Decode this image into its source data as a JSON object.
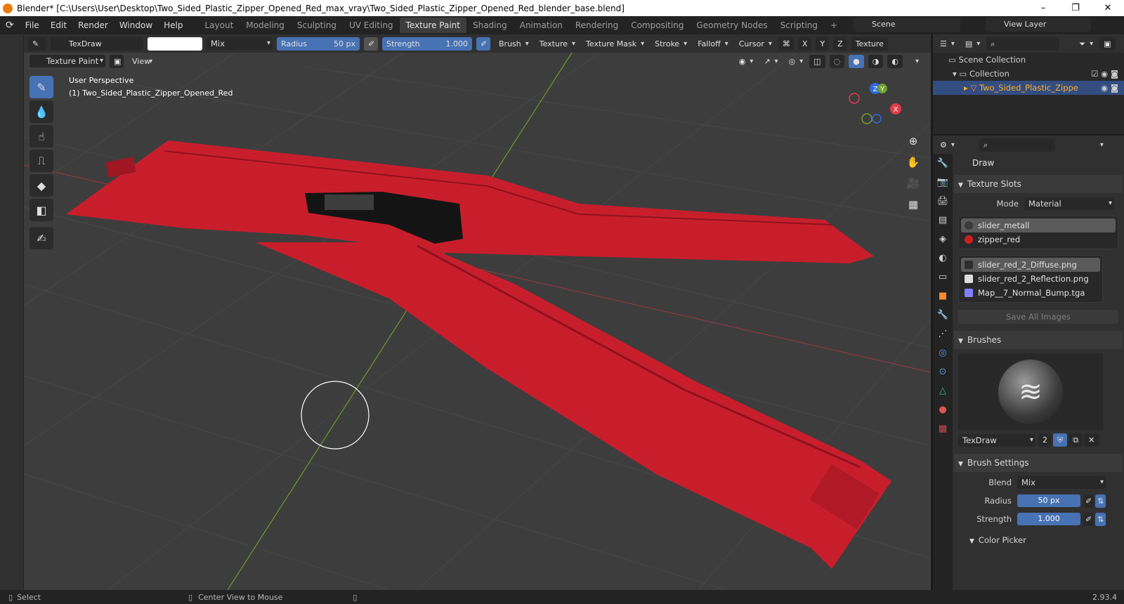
{
  "window": {
    "title": "Blender* [C:\\Users\\User\\Desktop\\Two_Sided_Plastic_Zipper_Opened_Red_max_vray\\Two_Sided_Plastic_Zipper_Opened_Red_blender_base.blend]",
    "minimize": "–",
    "maximize": "❐",
    "close": "✕"
  },
  "menu": [
    "File",
    "Edit",
    "Render",
    "Window",
    "Help"
  ],
  "workspaces": [
    "Layout",
    "Modeling",
    "Sculpting",
    "UV Editing",
    "Texture Paint",
    "Shading",
    "Animation",
    "Rendering",
    "Compositing",
    "Geometry Nodes",
    "Scripting",
    "+"
  ],
  "active_workspace": "Texture Paint",
  "scene": "Scene",
  "view_layer": "View Layer",
  "tool_header": {
    "brush_name": "TexDraw",
    "blend_mode": "Mix",
    "radius_label": "Radius",
    "radius_value": "50 px",
    "strength_label": "Strength",
    "strength_value": "1.000",
    "menus": [
      "Brush",
      "Texture",
      "Texture Mask",
      "Stroke",
      "Falloff",
      "Cursor"
    ],
    "axes": [
      "X",
      "Y",
      "Z"
    ],
    "texture_tab": "Texture"
  },
  "sub_header": {
    "mode": "Texture Paint",
    "view_menu": "View"
  },
  "viewport": {
    "perspective": "User Perspective",
    "object_info": "(1) Two_Sided_Plastic_Zipper_Opened_Red",
    "gizmo_axes": [
      "X",
      "Y",
      "Z"
    ]
  },
  "outliner": {
    "scene_collection": "Scene Collection",
    "collection": "Collection",
    "object": "Two_Sided_Plastic_Zippe"
  },
  "properties": {
    "tool_name": "Draw",
    "texture_slots": {
      "title": "Texture Slots",
      "mode_label": "Mode",
      "mode_value": "Material",
      "materials": [
        {
          "name": "slider_metall",
          "color": "#3a3a3a"
        },
        {
          "name": "zipper_red",
          "color": "#cc2020"
        }
      ],
      "images": [
        {
          "name": "slider_red_2_Diffuse.png",
          "color": "#2e2e2e"
        },
        {
          "name": "slider_red_2_Reflection.png",
          "color": "#dddddd"
        },
        {
          "name": "Map__7_Normal_Bump.tga",
          "color": "#8080ff"
        }
      ],
      "save_all": "Save All Images"
    },
    "brushes": {
      "title": "Brushes",
      "brush_name": "TexDraw",
      "users": "2"
    },
    "brush_settings": {
      "title": "Brush Settings",
      "blend_label": "Blend",
      "blend_value": "Mix",
      "radius_label": "Radius",
      "radius_value": "50 px",
      "strength_label": "Strength",
      "strength_value": "1.000"
    },
    "color_picker": "Color Picker"
  },
  "status_bar": {
    "select": "Select",
    "center_view": "Center View to Mouse",
    "version": "2.93.4"
  },
  "colors": {
    "accent": "#4772b3",
    "zipper_red": "#c81e2c",
    "selected_object": "#ffaf29"
  }
}
